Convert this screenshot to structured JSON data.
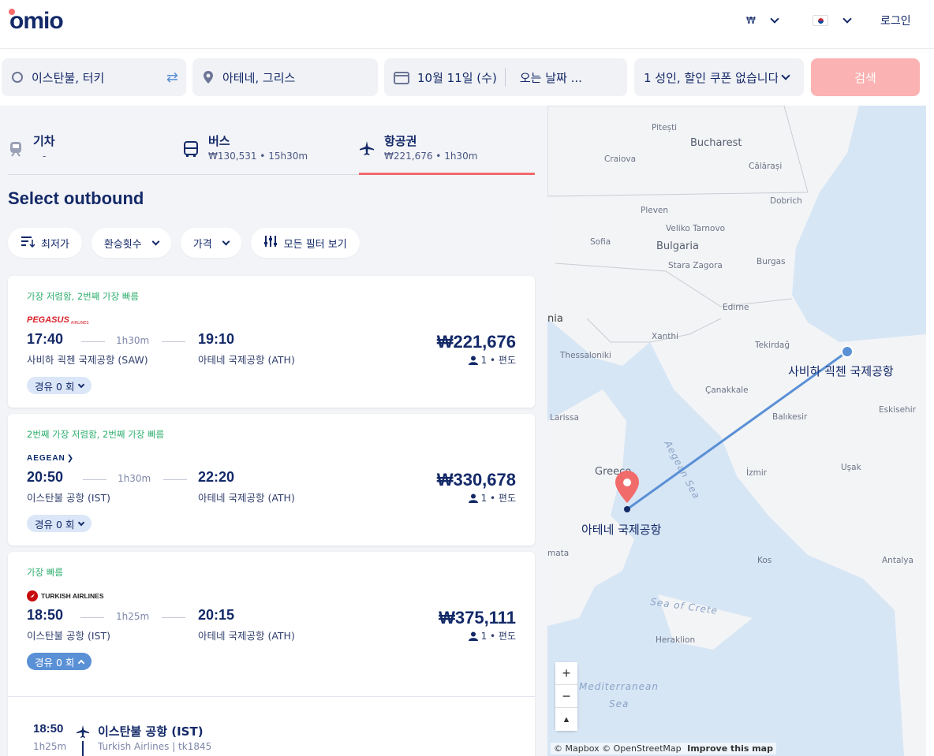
{
  "header": {
    "logo": "omio",
    "currency": "₩",
    "login": "로그인"
  },
  "search": {
    "from": "이스탄불, 터키",
    "to": "아테네, 그리스",
    "depart_date": "10월 11일 (수)",
    "return_placeholder": "오는 날짜 ...",
    "passengers": "1 성인, 할인 쿠폰 없습니다",
    "search_button": "검색"
  },
  "tabs": [
    {
      "title": "기차",
      "sub": "-"
    },
    {
      "title": "버스",
      "sub": "₩130,531 • 15h30m"
    },
    {
      "title": "항공권",
      "sub": "₩221,676 • 1h30m"
    }
  ],
  "page_title": "Select outbound",
  "filters": {
    "sort": "최저가",
    "transfers": "환승횟수",
    "price": "가격",
    "all_filters": "모든 필터 보기"
  },
  "results": [
    {
      "badge": "가장 저렴함, 2번째 가장 빠름",
      "airline": "PEGASUS",
      "airline_sub": "AIRLINES",
      "dep_time": "17:40",
      "duration": "1h30m",
      "arr_time": "19:10",
      "dep_airport": "사비하 괵첸 국제공항 (SAW)",
      "arr_airport": "아테네 국제공항 (ATH)",
      "price": "₩221,676",
      "per": "1 • 편도",
      "stops": "경유 0 회"
    },
    {
      "badge": "2번째 가장 저렴함, 2번째 가장 빠름",
      "airline": "AEGEAN",
      "dep_time": "20:50",
      "duration": "1h30m",
      "arr_time": "22:20",
      "dep_airport": "이스탄불 공항 (IST)",
      "arr_airport": "아테네 국제공항 (ATH)",
      "price": "₩330,678",
      "per": "1 • 편도",
      "stops": "경유 0 회"
    },
    {
      "badge": "가장 빠름",
      "airline": "TURKISH AIRLINES",
      "dep_time": "18:50",
      "duration": "1h25m",
      "arr_time": "20:15",
      "dep_airport": "이스탄불 공항 (IST)",
      "arr_airport": "아테네 국제공항 (ATH)",
      "price": "₩375,111",
      "per": "1 • 편도",
      "stops": "경유 0 회",
      "detail": {
        "time": "18:50",
        "duration": "1h25m",
        "airport": "이스탄불 공항 (IST)",
        "carrier": "Turkish Airlines | tk1845"
      }
    }
  ],
  "map": {
    "labels": {
      "pitesti": "Pitești",
      "bucharest": "Bucharest",
      "craiova": "Craiova",
      "calarasi": "Călărași",
      "dobrich": "Dobrich",
      "pleven": "Pleven",
      "veliko": "Veliko Tarnovo",
      "sofia": "Sofia",
      "bulgaria": "Bulgaria",
      "stara": "Stara Zagora",
      "burgas": "Burgas",
      "edirne": "Edirne",
      "nia": "nia",
      "xanthi": "Xanthi",
      "tekirdag": "Tekirdağ",
      "thessaloniki": "Thessaloniki",
      "canakkale": "Çanakkale",
      "eskisehir": "Eskisehir",
      "larissa": "Larissa",
      "balikesir": "Balıkesir",
      "aegean": "Aegean Sea",
      "greece": "Greece",
      "izmir": "İzmir",
      "usak": "Uşak",
      "mata": "mata",
      "kos": "Kos",
      "antalya": "Antalya",
      "crete_sea": "Sea of Crete",
      "heraklion": "Heraklion",
      "med": "Mediterranean",
      "sea": "Sea",
      "origin": "사비하 괵첸 국제공항",
      "dest": "아테네 국제공항"
    },
    "zoom_in": "+",
    "zoom_out": "−",
    "compass": "▲",
    "attribution": "© Mapbox © OpenStreetMap",
    "improve": "Improve this map"
  },
  "colors": {
    "brand_navy": "#132968",
    "accent_red": "#f26b6b",
    "route_blue": "#5a90d6",
    "badge_green": "#2fae6e"
  }
}
